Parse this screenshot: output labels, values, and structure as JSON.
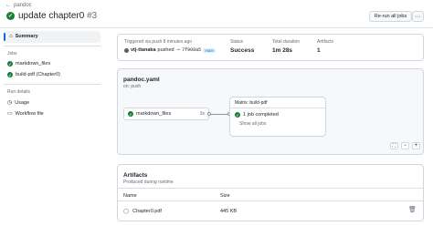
{
  "breadcrumb": {
    "back_icon": "arrow-left-icon",
    "label": "pandoc"
  },
  "title": {
    "text": "update chapter0",
    "number": "#3",
    "status_icon": "check-circle-icon"
  },
  "header_actions": {
    "rerun_label": "Re-run all jobs",
    "menu_glyph": "···"
  },
  "sidebar": {
    "summary": {
      "label": "Summary",
      "icon": "home-icon"
    },
    "jobs_heading": "Jobs",
    "jobs": [
      {
        "label": "markdown_files",
        "icon": "check-circle-icon"
      },
      {
        "label": "build-pdf (Chapter0)",
        "icon": "check-circle-icon"
      }
    ],
    "details_heading": "Run details",
    "details": [
      {
        "label": "Usage",
        "icon": "stopwatch-icon"
      },
      {
        "label": "Workflow file",
        "icon": "file-icon"
      }
    ]
  },
  "summary_card": {
    "triggered_text": "Triggered via push 8 minutes ago",
    "actor": "vtj-ttanaka",
    "pushed": "pushed",
    "commit": "7f908a5",
    "branch": "main",
    "status_label": "Status",
    "status_value": "Success",
    "duration_label": "Total duration",
    "duration_value": "1m 28s",
    "artifacts_label": "Artifacts",
    "artifacts_value": "1"
  },
  "workflow": {
    "file": "pandoc.yaml",
    "trigger": "on: push",
    "job1": {
      "label": "markdown_files",
      "duration": "3s"
    },
    "matrix": {
      "header": "Matrix: build-pdf",
      "status": "1 job completed",
      "show_all": "Show all jobs"
    },
    "zoom": {
      "fit": "⛶",
      "minus": "−",
      "plus": "+"
    }
  },
  "artifacts": {
    "title": "Artifacts",
    "subtitle": "Produced during runtime",
    "col_name": "Name",
    "col_size": "Size",
    "rows": [
      {
        "name": "Chapter0.pdf",
        "size": "445 KB",
        "icon": "package-icon",
        "delete_icon": "trash-icon"
      }
    ]
  },
  "colors": {
    "success": "#1a7f37",
    "accent": "#0969da"
  }
}
